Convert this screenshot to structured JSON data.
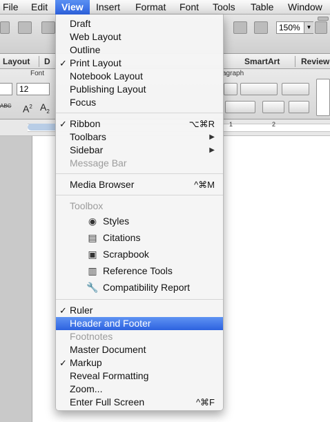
{
  "menubar": {
    "items": [
      "File",
      "Edit",
      "View",
      "Insert",
      "Format",
      "Font",
      "Tools",
      "Table",
      "Window"
    ]
  },
  "toolbar": {
    "zoom": "150%"
  },
  "ribbon_tabs": {
    "items": [
      "Layout",
      "D",
      "SmartArt",
      "Review"
    ]
  },
  "ribbon": {
    "font_group_label": "Font",
    "paragraph_group_label": "agraph",
    "font_size": "12",
    "strike_label": "ABC",
    "superscript_label": "A",
    "superscript_mark": "2",
    "subscript_label": "A",
    "subscript_mark": "2"
  },
  "ruler": {
    "marks": [
      "1",
      "2"
    ]
  },
  "view_menu": {
    "items": [
      {
        "label": "Draft",
        "checked": false
      },
      {
        "label": "Web Layout",
        "checked": false
      },
      {
        "label": "Outline",
        "checked": false
      },
      {
        "label": "Print Layout",
        "checked": true
      },
      {
        "label": "Notebook Layout",
        "checked": false
      },
      {
        "label": "Publishing Layout",
        "checked": false
      },
      {
        "label": "Focus",
        "checked": false
      }
    ],
    "items2": [
      {
        "label": "Ribbon",
        "checked": true,
        "shortcut": "⌥⌘R"
      },
      {
        "label": "Toolbars",
        "submenu": true
      },
      {
        "label": "Sidebar",
        "submenu": true
      },
      {
        "label": "Message Bar",
        "disabled": true
      }
    ],
    "media_browser": {
      "label": "Media Browser",
      "shortcut": "^⌘M"
    },
    "toolbox": {
      "header": "Toolbox",
      "items": [
        {
          "label": "Styles",
          "icon": "styles-icon"
        },
        {
          "label": "Citations",
          "icon": "citations-icon"
        },
        {
          "label": "Scrapbook",
          "icon": "scrapbook-icon"
        },
        {
          "label": "Reference Tools",
          "icon": "reference-tools-icon"
        },
        {
          "label": "Compatibility Report",
          "icon": "wrench-icon"
        }
      ]
    },
    "items3": [
      {
        "label": "Ruler",
        "checked": true
      },
      {
        "label": "Header and Footer",
        "highlighted": true
      },
      {
        "label": "Footnotes",
        "disabled": true
      },
      {
        "label": "Master Document"
      },
      {
        "label": "Markup",
        "checked": true
      },
      {
        "label": "Reveal Formatting"
      },
      {
        "label": "Zoom..."
      },
      {
        "label": "Enter Full Screen",
        "shortcut": "^⌘F"
      }
    ],
    "check_glyph": "✓",
    "submenu_glyph": "▶"
  }
}
